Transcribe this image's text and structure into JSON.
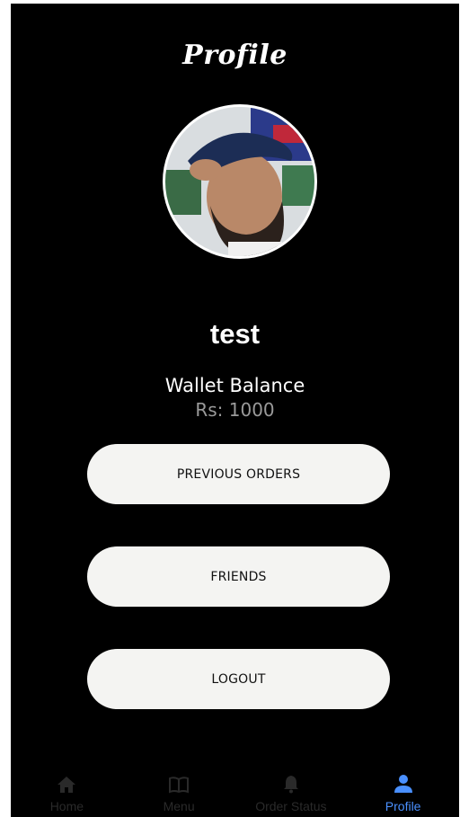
{
  "header": {
    "title": "Profile"
  },
  "profile": {
    "username": "test",
    "wallet_label": "Wallet Balance",
    "wallet_amount": "Rs: 1000"
  },
  "buttons": {
    "previous_orders": "PREVIOUS ORDERS",
    "friends": "FRIENDS",
    "logout": "LOGOUT"
  },
  "bottom_nav": {
    "items": [
      {
        "label": "Home",
        "icon": "home-icon"
      },
      {
        "label": "Menu",
        "icon": "book-icon"
      },
      {
        "label": "Order Status",
        "icon": "bell-icon"
      },
      {
        "label": "Profile",
        "icon": "person-icon",
        "active": true
      }
    ]
  },
  "colors": {
    "background": "#000000",
    "button_bg": "#f4f4f2",
    "active_tab": "#4a90ff",
    "inactive_tab": "#2a2a2a",
    "wallet_amount": "#9a9a9a"
  }
}
